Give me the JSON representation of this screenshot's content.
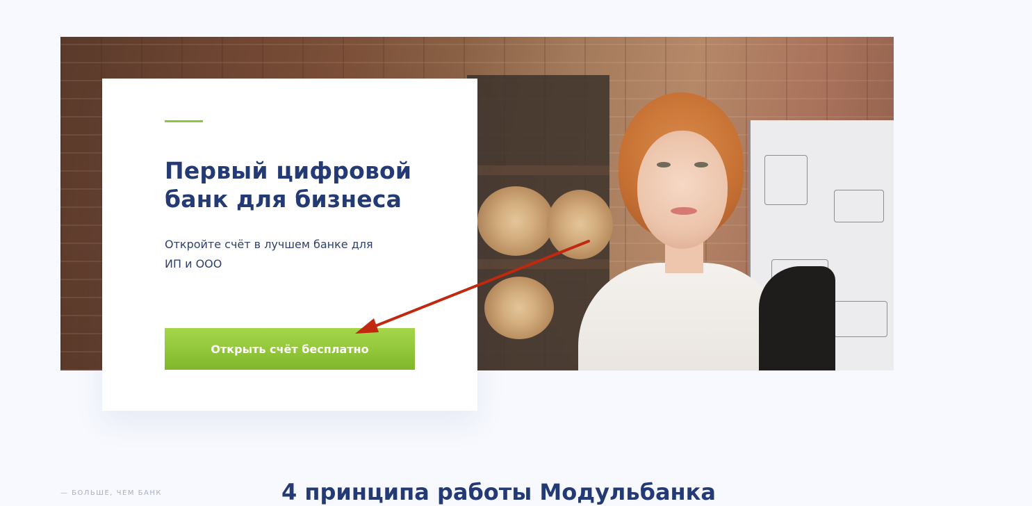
{
  "hero": {
    "photo_alt": "Photo of a smiling woman in a workshop with brick wall, shelves with wooden slices and furniture sketches"
  },
  "promo": {
    "title": "Первый цифровой банк для бизнеса",
    "subtitle": "Откройте счёт в лучшем банке для ИП и ООО",
    "cta_label": "Открыть счёт бесплатно"
  },
  "next_section": {
    "eyebrow": "— БОЛЬШЕ, ЧЕМ БАНК",
    "title": "4 принципа работы Модульбанка"
  },
  "colors": {
    "page_background": "#f7f9fe",
    "title_blue": "#233a75",
    "accent_green": "#8cc63f",
    "cta_green": "#92c63a",
    "annotation_arrow": "#c0280f"
  }
}
